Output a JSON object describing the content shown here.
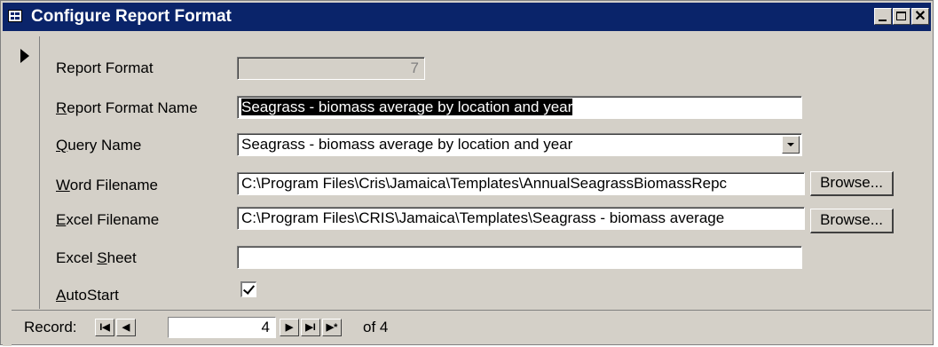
{
  "window": {
    "title": "Configure Report Format",
    "minimize_icon": "minimize-icon",
    "maximize_icon": "maximize-icon",
    "close_glyph": "✕"
  },
  "form": {
    "report_format": {
      "label": "Report Format",
      "value": "7"
    },
    "report_format_name": {
      "label_accel": "R",
      "label_rest": "eport Format Name",
      "value": "Seagrass - biomass average by location and year"
    },
    "query_name": {
      "label_accel": "Q",
      "label_rest": "uery Name",
      "value": "Seagrass - biomass average by location and year"
    },
    "word_filename": {
      "label_accel": "W",
      "label_rest": "ord Filename",
      "value": "C:\\Program Files\\Cris\\Jamaica\\Templates\\AnnualSeagrassBiomassRepc",
      "browse_label": "Browse..."
    },
    "excel_filename": {
      "label_accel": "E",
      "label_rest": "xcel Filename",
      "value": "C:\\Program Files\\CRIS\\Jamaica\\Templates\\Seagrass - biomass average",
      "browse_label": "Browse..."
    },
    "excel_sheet": {
      "label_pre": "Excel ",
      "label_accel": "S",
      "label_rest": "heet",
      "value": ""
    },
    "autostart": {
      "label_accel": "A",
      "label_rest": "utoStart",
      "checked": true
    }
  },
  "navigation": {
    "record_label": "Record:",
    "first_glyph": "I◀",
    "prev_glyph": "◀",
    "current": "4",
    "next_glyph": "▶",
    "last_glyph": "▶I",
    "new_glyph": "▶*",
    "of_text": "of 4"
  }
}
